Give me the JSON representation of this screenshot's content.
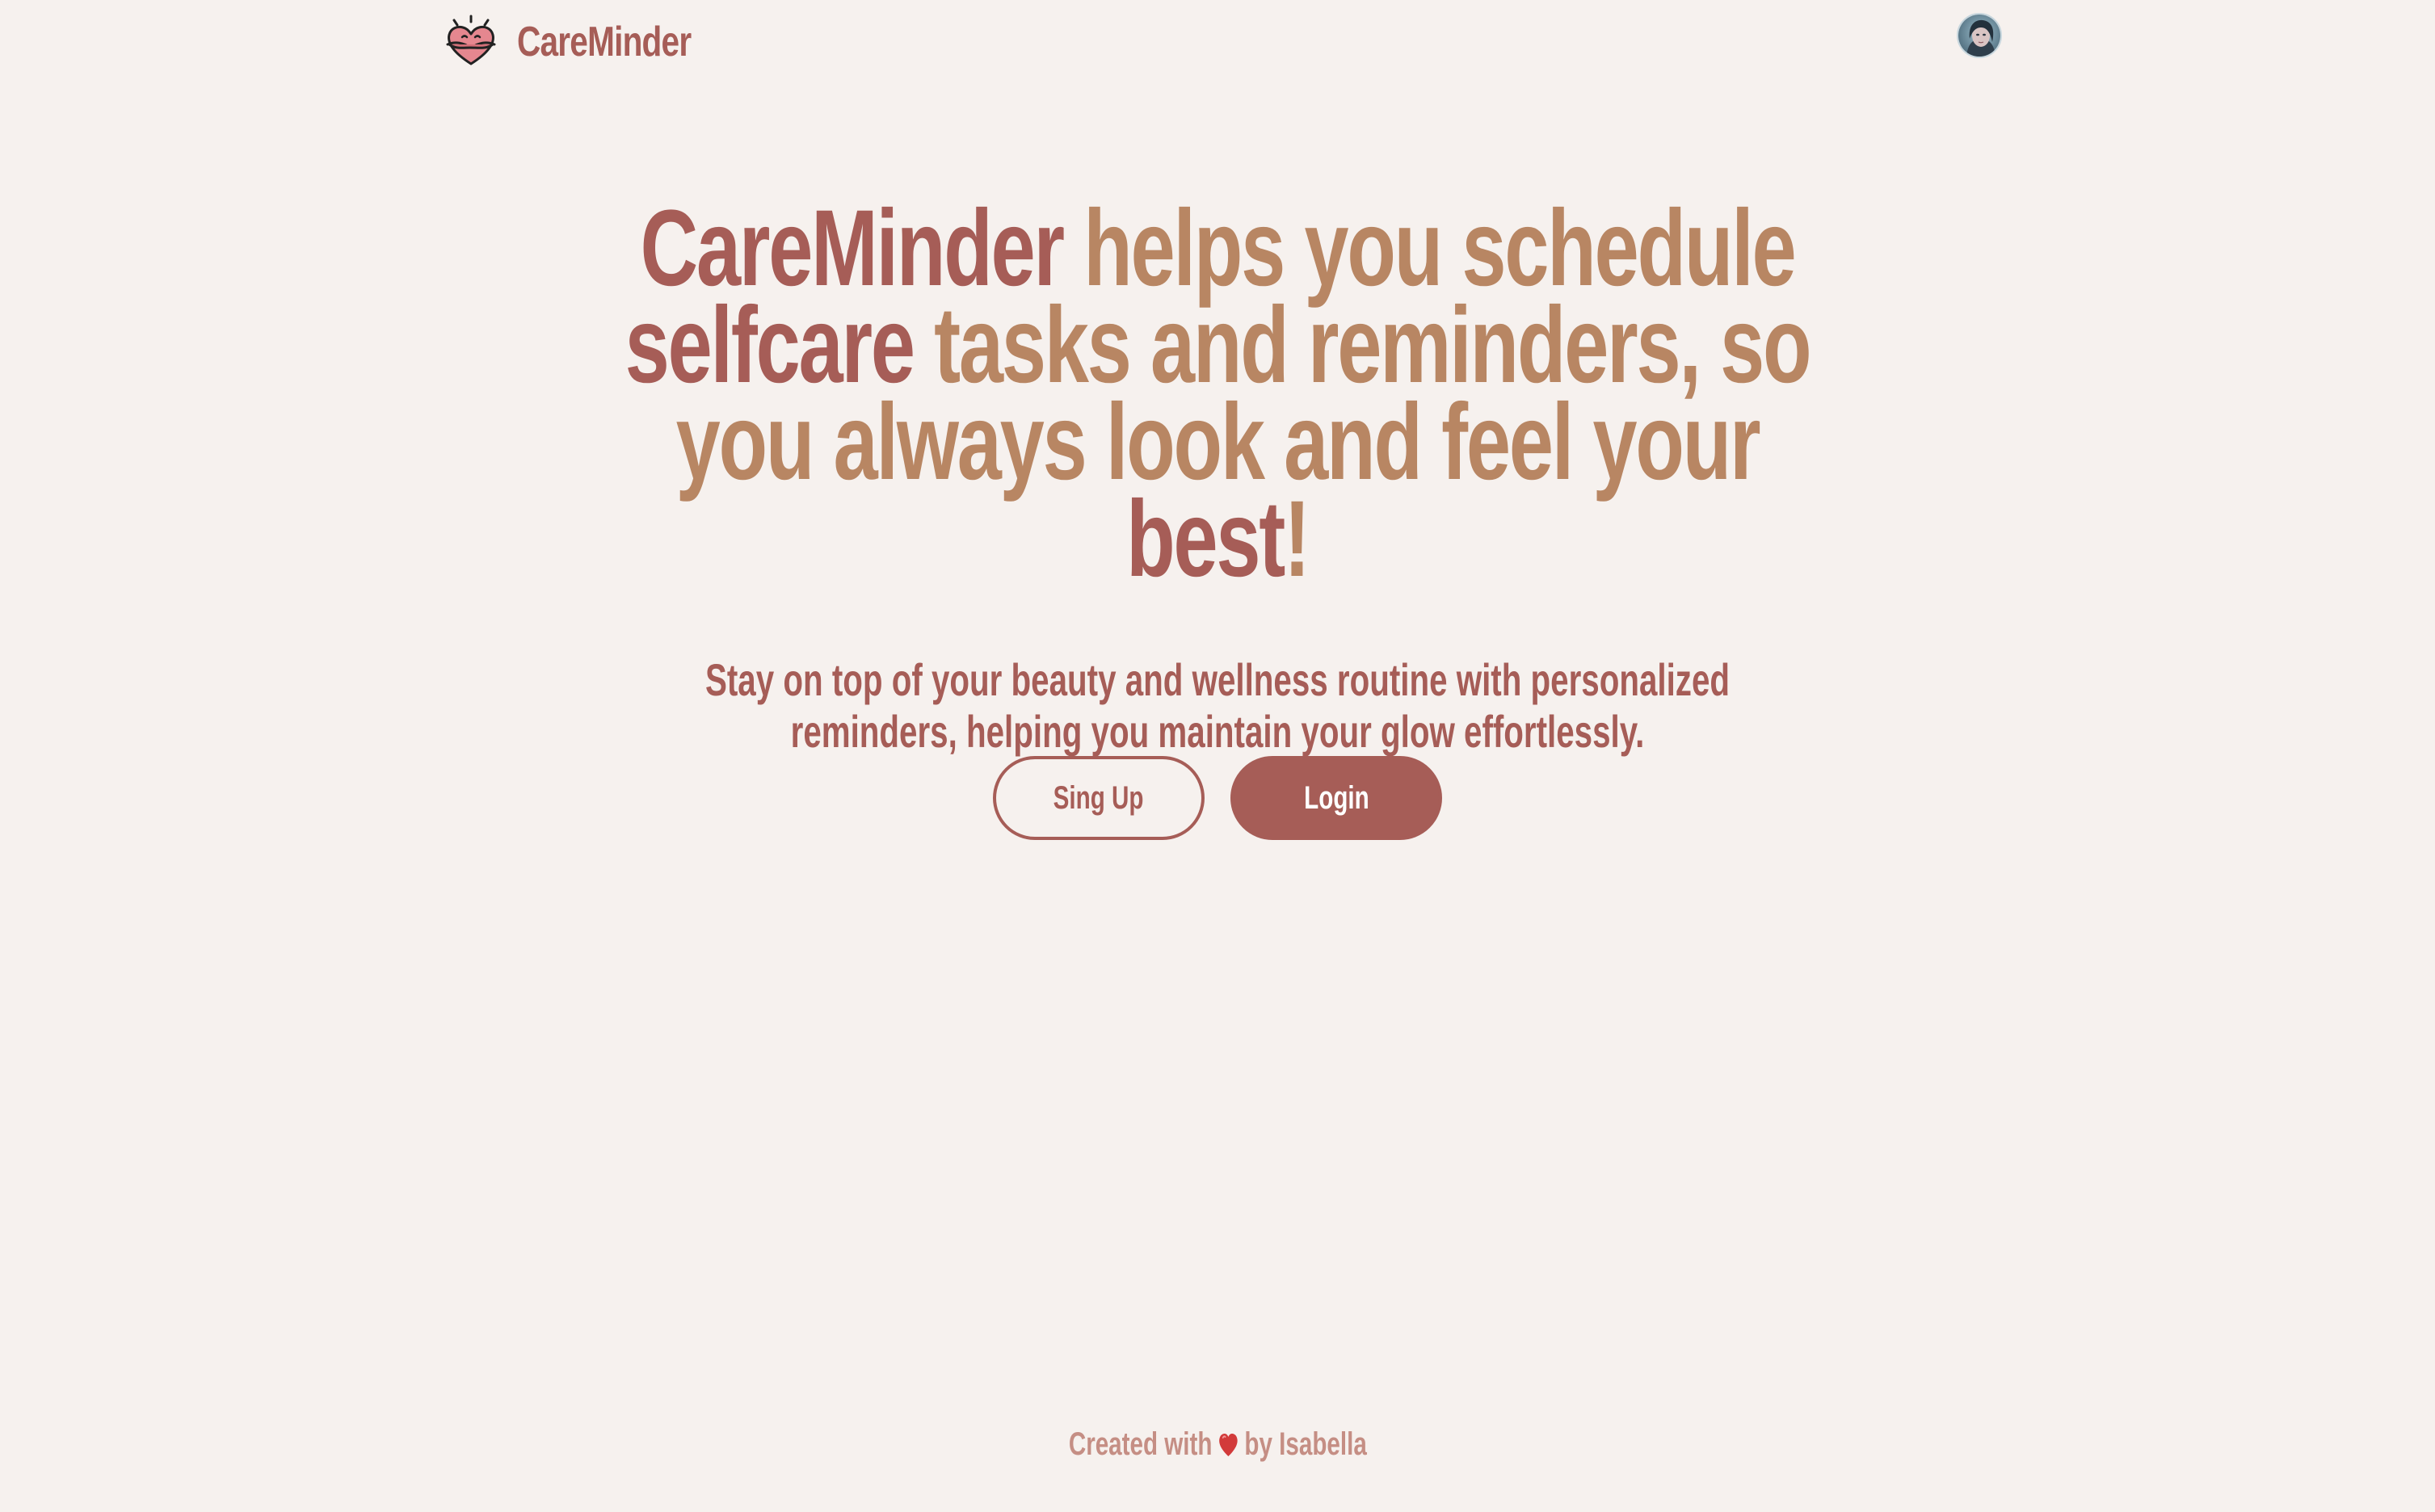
{
  "header": {
    "brand": "CareMinder",
    "logo_icon": "heart-hug-icon",
    "avatar_icon": "user-avatar"
  },
  "hero": {
    "headline_parts": [
      {
        "text": "CareMinder",
        "highlight": true
      },
      {
        "text": " helps you schedule ",
        "highlight": false
      },
      {
        "text": "selfcare",
        "highlight": true
      },
      {
        "text": " tasks and reminders, so you always look and feel your ",
        "highlight": false
      },
      {
        "text": "best",
        "highlight": true
      },
      {
        "text": "!",
        "highlight": false
      }
    ],
    "subtext": "Stay on top of your beauty and wellness routine with personalized reminders, helping you maintain your glow effortlessly."
  },
  "buttons": {
    "signup_label": "Sing Up",
    "login_label": "Login"
  },
  "footer": {
    "prefix": "Created with",
    "icon": "heart-icon",
    "suffix": "by Isabella"
  },
  "colors": {
    "background": "#f6f1ee",
    "primary": "#a65d57",
    "secondary": "#b88663",
    "footer_text": "#c58e84"
  }
}
